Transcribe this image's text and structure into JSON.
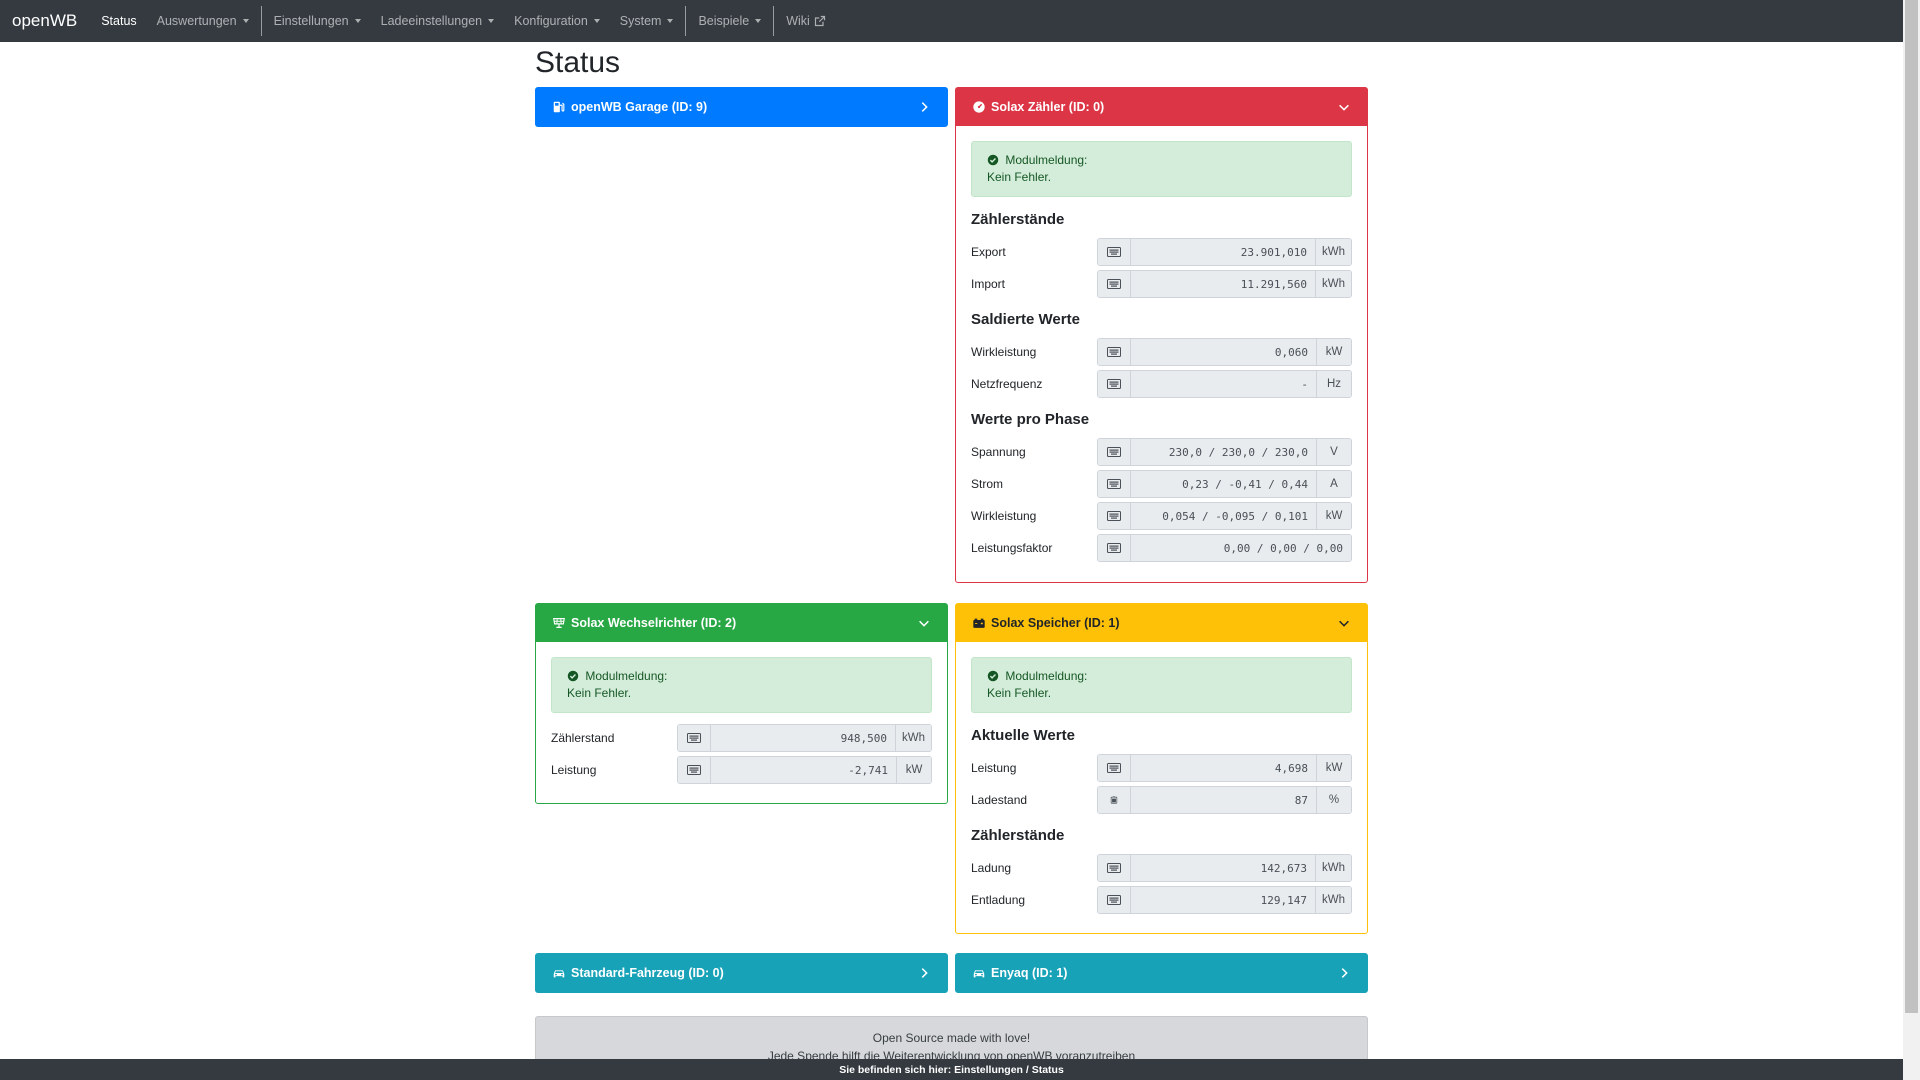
{
  "nav": {
    "brand": "openWB",
    "status": "Status",
    "auswertungen": "Auswertungen",
    "einstellungen": "Einstellungen",
    "ladeeinstellungen": "Ladeeinstellungen",
    "konfiguration": "Konfiguration",
    "system": "System",
    "beispiele": "Beispiele",
    "wiki": "Wiki"
  },
  "page_title": "Status",
  "cards": {
    "garage": {
      "title": "openWB Garage (ID: 9)",
      "color": "#007bff",
      "icon": "charging-station-icon"
    },
    "zaehler": {
      "title": "Solax Zähler (ID: 0)",
      "color": "#dc3545",
      "icon": "gauge-icon",
      "alert_title": "Modulmeldung:",
      "alert_text": "Kein Fehler.",
      "sections": {
        "s1": "Zählerstände",
        "s2": "Saldierte Werte",
        "s3": "Werte pro Phase"
      },
      "rows": {
        "export": {
          "label": "Export",
          "value": "23.901,010",
          "unit": "kWh"
        },
        "import": {
          "label": "Import",
          "value": "11.291,560",
          "unit": "kWh"
        },
        "wirkleistung": {
          "label": "Wirkleistung",
          "value": "0,060",
          "unit": "kW"
        },
        "netzfrequenz": {
          "label": "Netzfrequenz",
          "value": "-",
          "unit": "Hz"
        },
        "spannung": {
          "label": "Spannung",
          "value": "230,0 / 230,0 / 230,0",
          "unit": "V"
        },
        "strom": {
          "label": "Strom",
          "value": "0,23 / -0,41 / 0,44",
          "unit": "A"
        },
        "wirkleistung_phase": {
          "label": "Wirkleistung",
          "value": "0,054 / -0,095 / 0,101",
          "unit": "kW"
        },
        "leistungsfaktor": {
          "label": "Leistungsfaktor",
          "value": "0,00 / 0,00 / 0,00"
        }
      }
    },
    "wechselrichter": {
      "title": "Solax Wechselrichter (ID: 2)",
      "color": "#28a745",
      "icon": "solar-panel-icon",
      "alert_title": "Modulmeldung:",
      "alert_text": "Kein Fehler.",
      "rows": {
        "zaehlerstand": {
          "label": "Zählerstand",
          "value": "948,500",
          "unit": "kWh"
        },
        "leistung": {
          "label": "Leistung",
          "value": "-2,741",
          "unit": "kW"
        }
      }
    },
    "speicher": {
      "title": "Solax Speicher (ID: 1)",
      "color": "#ffc107",
      "icon": "car-battery-icon",
      "alert_title": "Modulmeldung:",
      "alert_text": "Kein Fehler.",
      "sections": {
        "s1": "Aktuelle Werte",
        "s2": "Zählerstände"
      },
      "rows": {
        "leistung": {
          "label": "Leistung",
          "value": "4,698",
          "unit": "kW"
        },
        "ladestand": {
          "label": "Ladestand",
          "value": "87",
          "unit": "%"
        },
        "ladung": {
          "label": "Ladung",
          "value": "142,673",
          "unit": "kWh"
        },
        "entladung": {
          "label": "Entladung",
          "value": "129,147",
          "unit": "kWh"
        }
      }
    },
    "fahrzeug": {
      "title": "Standard-Fahrzeug (ID: 0)",
      "color": "#17a2b8",
      "icon": "car-icon"
    },
    "enyaq": {
      "title": "Enyaq (ID: 1)",
      "color": "#17a2b8",
      "icon": "car-icon"
    }
  },
  "footer": {
    "line1": "Open Source made with love!",
    "line2": "Jede Spende hilft die Weiterentwicklung von openWB voranzutreiben"
  },
  "breadcrumb": "Sie befinden sich hier: Einstellungen / Status"
}
